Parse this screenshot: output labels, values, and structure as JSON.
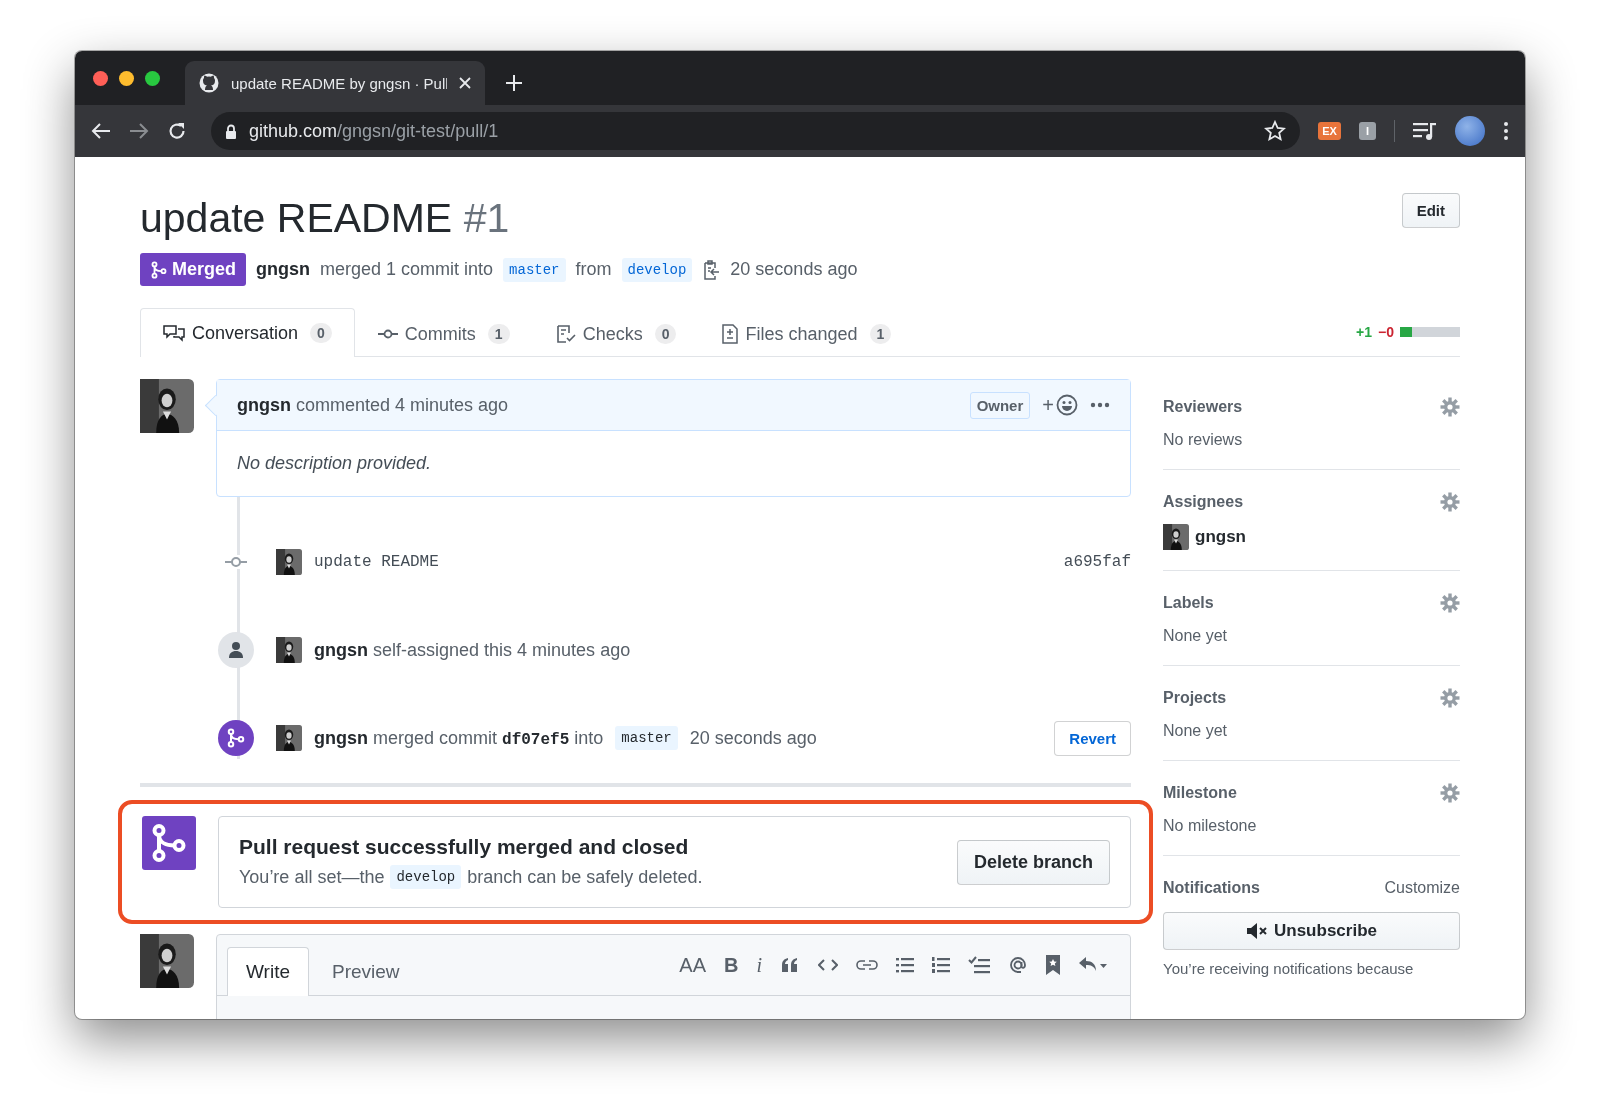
{
  "browser": {
    "tab_title": "update README by gngsn · Pull",
    "url_host": "github.com",
    "url_path": "/gngsn/git-test/pull/1",
    "extensions": [
      "EX",
      "I"
    ]
  },
  "pull_request": {
    "title": "update README",
    "number": "#1",
    "edit": "Edit",
    "status": "Merged",
    "author": "gngsn",
    "summary": "merged 1 commit into",
    "base": "master",
    "from": "from",
    "head": "develop",
    "time": "20 seconds ago"
  },
  "tabs": [
    {
      "kind": "conversation",
      "label": "Conversation",
      "count": "0",
      "selected": true
    },
    {
      "kind": "commits",
      "label": "Commits",
      "count": "1",
      "selected": false
    },
    {
      "kind": "checks",
      "label": "Checks",
      "count": "0",
      "selected": false
    },
    {
      "kind": "files",
      "label": "Files changed",
      "count": "1",
      "selected": false
    }
  ],
  "diffstat": {
    "added": "+1",
    "removed": "−0",
    "level": 0.2
  },
  "comment": {
    "author": "gngsn",
    "action": "commented 4 minutes ago",
    "role": "Owner",
    "reaction": "+",
    "body": "No description provided."
  },
  "events": [
    {
      "kind": "commit",
      "message": "update README",
      "sha": "a695faf"
    },
    {
      "kind": "assign",
      "author": "gngsn",
      "text": "self-assigned this 4 minutes ago"
    },
    {
      "kind": "merge",
      "author": "gngsn",
      "text": "merged commit",
      "sha": "df07ef5",
      "into": "into",
      "branch": "master",
      "time": "20 seconds ago",
      "button": "Revert"
    }
  ],
  "merge_box": {
    "title": "Pull request successfully merged and closed",
    "before": "You’re all set—the",
    "branch": "develop",
    "after": "branch can be safely deleted.",
    "button": "Delete branch",
    "highlighted": true
  },
  "composer": {
    "tabs": [
      {
        "label": "Write",
        "selected": true
      },
      {
        "label": "Preview",
        "selected": false
      }
    ],
    "toolbar": [
      {
        "kind": "heading",
        "label": "AA"
      },
      {
        "kind": "bold",
        "label": "B"
      },
      {
        "kind": "italic",
        "label": "i"
      },
      {
        "kind": "quote"
      },
      {
        "kind": "code"
      },
      {
        "kind": "link"
      },
      {
        "kind": "bullets"
      },
      {
        "kind": "numbers"
      },
      {
        "kind": "tasks"
      },
      {
        "kind": "mention"
      },
      {
        "kind": "bookmark"
      },
      {
        "kind": "reply"
      }
    ]
  },
  "sidebar": [
    {
      "heading": "Reviewers",
      "value": "No reviews"
    },
    {
      "heading": "Assignees",
      "user": "gngsn"
    },
    {
      "heading": "Labels",
      "value": "None yet"
    },
    {
      "heading": "Projects",
      "value": "None yet"
    },
    {
      "heading": "Milestone",
      "value": "No milestone"
    }
  ],
  "notifications": {
    "heading": "Notifications",
    "customize": "Customize",
    "button": "Unsubscribe",
    "note": "You’re receiving notifications because"
  }
}
